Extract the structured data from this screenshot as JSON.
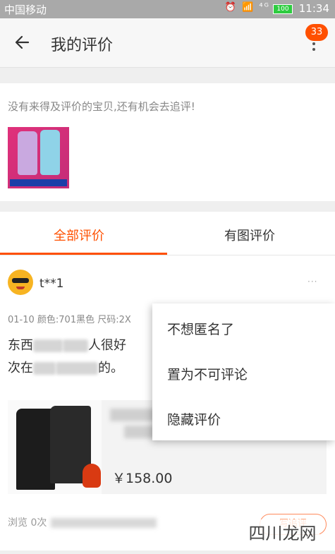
{
  "statusbar": {
    "carrier": "中国移动",
    "icons": "⏰ 📶 ⁴ᴳ",
    "battery": "100",
    "time": "11:34"
  },
  "navbar": {
    "title": "我的评价",
    "badge": "33"
  },
  "pending": {
    "hint": "没有来得及评价的宝贝,还有机会去追评!"
  },
  "tabs": {
    "all": "全部评价",
    "with_images": "有图评价"
  },
  "review": {
    "username": "t**1",
    "meta": "01-10  颜色:701黑色  尺码:2X",
    "line1_start": "东西",
    "line1_end": "人很好",
    "line2_start": "次在",
    "line2_end": "的。",
    "more_icon": "···"
  },
  "product": {
    "price": "￥158.00"
  },
  "stats": {
    "views_prefix": "浏览 0次",
    "followup_label": "写追评"
  },
  "menu": {
    "item1": "不想匿名了",
    "item2": "置为不可评论",
    "item3": "隐藏评价"
  },
  "watermark": "四川龙网"
}
